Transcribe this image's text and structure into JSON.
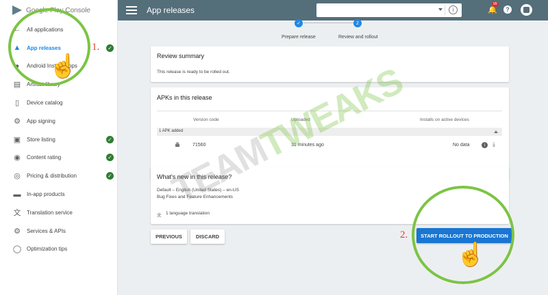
{
  "brand": {
    "name": "Google Play Console"
  },
  "header": {
    "title": "App releases",
    "app_select_value": "",
    "notification_count": "99"
  },
  "sidebar": {
    "items": [
      {
        "label": "All applications",
        "icon": "arrow-back-icon",
        "checked": false
      },
      {
        "label": "App releases",
        "icon": "rocket-icon",
        "checked": true,
        "active": true
      },
      {
        "label": "Android Instant Apps",
        "icon": "instant-icon",
        "checked": false
      },
      {
        "label": "Artifact library",
        "icon": "library-icon",
        "checked": false
      },
      {
        "label": "Device catalog",
        "icon": "device-icon",
        "checked": false
      },
      {
        "label": "App signing",
        "icon": "key-icon",
        "checked": false
      },
      {
        "label": "Store listing",
        "icon": "store-icon",
        "checked": true
      },
      {
        "label": "Content rating",
        "icon": "rating-icon",
        "checked": true
      },
      {
        "label": "Pricing & distribution",
        "icon": "globe-icon",
        "checked": true
      },
      {
        "label": "In-app products",
        "icon": "card-icon",
        "checked": false
      },
      {
        "label": "Translation service",
        "icon": "translate-icon",
        "checked": false
      },
      {
        "label": "Services & APIs",
        "icon": "gear-icon",
        "checked": false
      },
      {
        "label": "Optimization tips",
        "icon": "bulb-icon",
        "checked": false
      }
    ]
  },
  "stepper": {
    "step1_label": "Prepare release",
    "step2_label": "Review and rollout",
    "step2_number": "2"
  },
  "review_summary": {
    "title": "Review summary",
    "text": "This release is ready to be rolled out."
  },
  "apks": {
    "title": "APKs in this release",
    "col_version": "Version code",
    "col_uploaded": "Uploaded",
    "col_installs": "Installs on active devices",
    "group_label": "1 APK added",
    "row": {
      "version": "71560",
      "uploaded": "31 minutes ago",
      "installs": "No data"
    }
  },
  "whats_new": {
    "title": "What's new in this release?",
    "language": "Default – English (United States) – en-US",
    "notes": "Bug Fixes and Feature Enhancements",
    "translation": "1 language translation"
  },
  "buttons": {
    "previous": "PREVIOUS",
    "discard": "DISCARD",
    "start_rollout": "START ROLLOUT TO PRODUCTION"
  },
  "annotations": {
    "step1": "1.",
    "step2": "2.",
    "watermark_a": "TEAM",
    "watermark_b": "TWEAKS"
  },
  "colors": {
    "topbar": "#546e7a",
    "accent": "#1e88e5",
    "primary_button": "#1976d2",
    "check_green": "#2e7d32",
    "annotation_ring": "#7cc444",
    "annotation_number": "#e53935"
  }
}
